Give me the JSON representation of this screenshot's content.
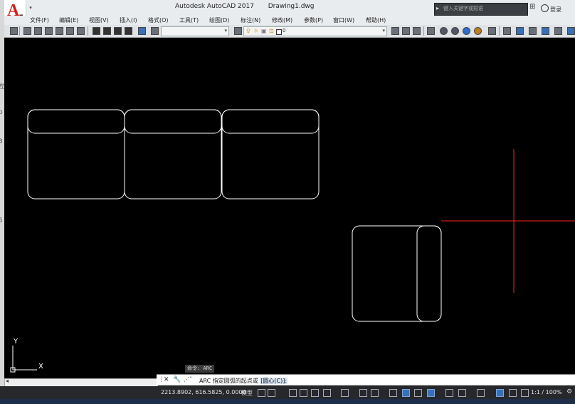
{
  "title": {
    "app": "Autodesk AutoCAD 2017",
    "document": "Drawing1.dwg",
    "search_placeholder": "键入关键字或短语",
    "login": "登录"
  },
  "menu": [
    "文件(F)",
    "编辑(E)",
    "视图(V)",
    "插入(I)",
    "格式(O)",
    "工具(T)",
    "绘图(D)",
    "标注(N)",
    "修改(M)",
    "参数(P)",
    "窗口(W)",
    "帮助(H)"
  ],
  "toolbar": {
    "layer_value": "0"
  },
  "left_strip_chars": [
    "左",
    "b",
    "3",
    "5"
  ],
  "ucs": {
    "y_label": "Y",
    "x_label": "X"
  },
  "command": {
    "history": "命令: ARC",
    "current": "ARC 指定圆弧的起点或",
    "option": "[圆心(C)]:"
  },
  "status": {
    "coordinates": "2213.8902, 616.5825, 0.0000",
    "model": "模型",
    "scale": "1:1 / 100%"
  },
  "colors": {
    "background": "#000000",
    "geometry": "#ffffff",
    "crosshair": "#ff2020",
    "brand": "#d0201a"
  }
}
